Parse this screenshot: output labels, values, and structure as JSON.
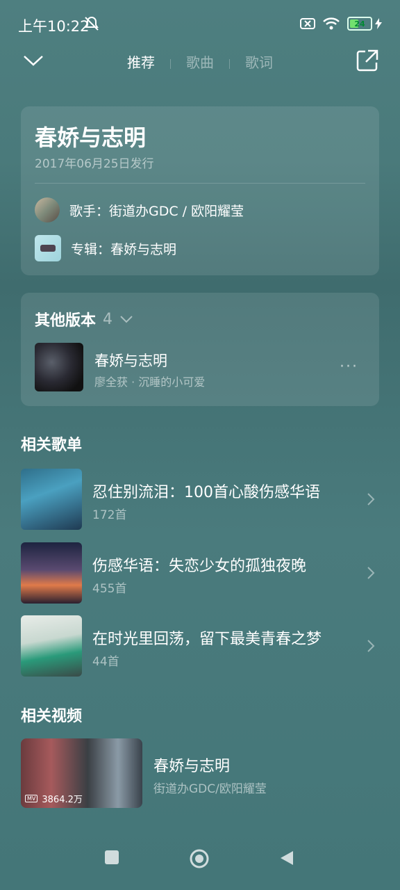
{
  "status_bar": {
    "time": "上午10:22",
    "battery": "24"
  },
  "tabs": {
    "recommend": "推荐",
    "songs": "歌曲",
    "lyrics": "歌词"
  },
  "song": {
    "title": "春娇与志明",
    "release": "2017年06月25日发行",
    "singer": "歌手：街道办GDC / 欧阳耀莹",
    "album": "专辑：春娇与志明"
  },
  "other_versions": {
    "label": "其他版本",
    "count": "4",
    "item": {
      "name": "春娇与志明",
      "sub": "廖全获 · 沉睡的小可爱"
    }
  },
  "related_playlists": {
    "title": "相关歌单",
    "items": [
      {
        "name": "忍住别流泪：100首心酸伤感华语",
        "count": "172首"
      },
      {
        "name": "伤感华语：失恋少女的孤独夜晚",
        "count": "455首"
      },
      {
        "name": "在时光里回荡，留下最美青春之梦",
        "count": "44首"
      }
    ]
  },
  "related_videos": {
    "title": "相关视频",
    "item": {
      "name": "春娇与志明",
      "sub": "街道办GDC/欧阳耀莹",
      "badge": "MV",
      "plays": "3864.2万"
    }
  },
  "colors": {
    "background": "#4a7a7b",
    "accent_battery": "#72e06e"
  }
}
